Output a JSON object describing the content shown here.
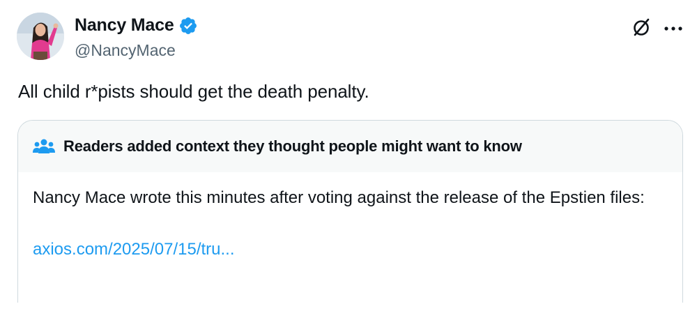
{
  "author": {
    "display_name": "Nancy Mace",
    "handle": "@NancyMace",
    "verified": true,
    "avatar_icon": "profile-photo"
  },
  "tweet": {
    "text": "All child r*pists should get the death penalty."
  },
  "actions": {
    "grok_icon": "grok-icon",
    "more_icon": "more-icon"
  },
  "community_note": {
    "icon": "people-icon",
    "title": "Readers added context they thought people might want to know",
    "body": "Nancy Mace wrote this minutes after voting against the release of the Epstien files:",
    "link": "axios.com/2025/07/15/tru..."
  },
  "colors": {
    "text": "#0f1419",
    "secondary_text": "#536471",
    "link": "#1d9bf0",
    "verified": "#1d9bf0",
    "note_header_bg": "#f7f9f9",
    "border": "#cfd9de"
  }
}
